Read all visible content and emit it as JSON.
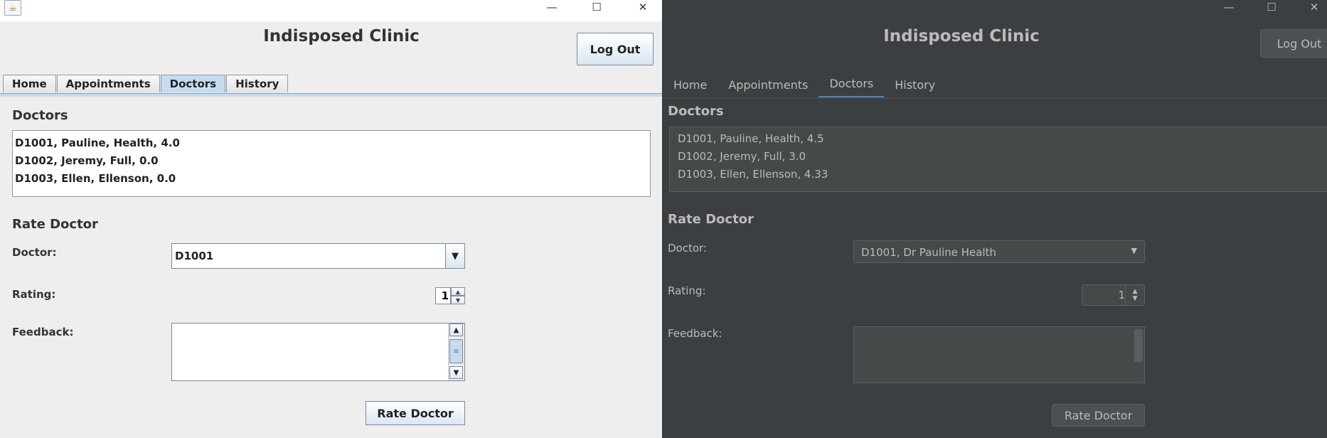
{
  "left": {
    "window": {
      "minimize": "—",
      "maximize": "☐",
      "close": "✕",
      "app_icon": "java-cup-icon"
    },
    "title": "Indisposed Clinic",
    "logout": "Log Out",
    "tabs": [
      "Home",
      "Appointments",
      "Doctors",
      "History"
    ],
    "active_tab": "Doctors",
    "doctors_heading": "Doctors",
    "doctors": [
      "D1001, Pauline, Health, 4.0",
      "D1002, Jeremy, Full, 0.0",
      "D1003, Ellen, Ellenson, 0.0"
    ],
    "rate_heading": "Rate Doctor",
    "doctor_label": "Doctor:",
    "doctor_value": "D1001",
    "rating_label": "Rating:",
    "rating_value": "1",
    "feedback_label": "Feedback:",
    "feedback_value": "",
    "rate_button": "Rate Doctor"
  },
  "right": {
    "window": {
      "minimize": "—",
      "maximize": "☐",
      "close": "✕"
    },
    "title": "Indisposed Clinic",
    "logout": "Log Out",
    "tabs": [
      "Home",
      "Appointments",
      "Doctors",
      "History"
    ],
    "active_tab": "Doctors",
    "doctors_heading": "Doctors",
    "doctors": [
      "D1001, Pauline, Health, 4.5",
      "D1002, Jeremy, Full, 3.0",
      "D1003, Ellen, Ellenson, 4.33"
    ],
    "rate_heading": "Rate Doctor",
    "doctor_label": "Doctor:",
    "doctor_value": "D1001, Dr Pauline Health",
    "rating_label": "Rating:",
    "rating_value": "1",
    "feedback_label": "Feedback:",
    "feedback_value": "",
    "rate_button": "Rate Doctor"
  },
  "colors": {
    "left_bg": "#eeeeee",
    "left_tab_active": "#c6dbee",
    "right_bg": "#3c3f41",
    "right_tab_indicator": "#4a88c7"
  }
}
